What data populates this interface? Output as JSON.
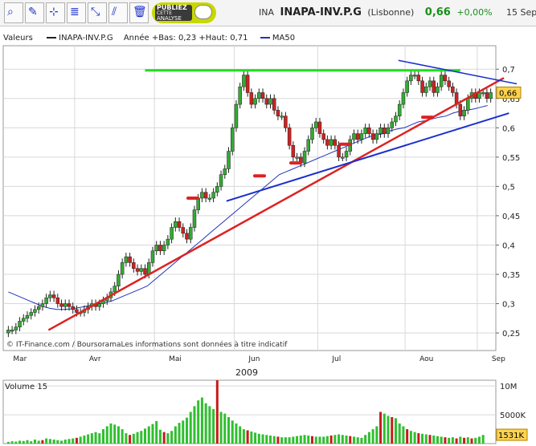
{
  "toolbar": {
    "tools": [
      "zoom-icon",
      "pencil-icon",
      "crosshair-icon",
      "fibonacci-icon",
      "arrows-icon",
      "channel-icon",
      "trash-icon"
    ],
    "ad_line1": "PUBLIEZ",
    "ad_line2": "CETTE",
    "ad_line3": "ANALYSE"
  },
  "quote": {
    "code": "INA",
    "name": "INAPA-INV.P.G",
    "market": "(Lisbonne)",
    "price": "0,66",
    "change": "+0,00%",
    "date": "15 Sep"
  },
  "legend": {
    "label": "Valeurs",
    "series_name": "INAPA-INV.P.G",
    "info": "Année +Bas: 0,23 +Haut: 0,71",
    "ma_name": "MA50"
  },
  "colors": {
    "up": "#33aa33",
    "down": "#cc2222",
    "ma": "#2233bb",
    "trend": "#dd2222",
    "support": "#1a2fcc",
    "resistance": "#22dd22",
    "volume_up": "#2fbf2f",
    "volume_down": "#c41c1c",
    "grid": "#d8d8d8"
  },
  "credit": "© IT-Finance.com / BoursoramaLes informations sont données à titre indicatif",
  "current_price_label": "0,66",
  "current_volume_label": "1531K",
  "chart_data": [
    {
      "type": "candlestick",
      "ticker": "INAPA-INV.P.G",
      "year": "2009",
      "x_labels": [
        "Mar",
        "Avr",
        "Mai",
        "Jun",
        "Jul",
        "Aou",
        "Sep"
      ],
      "y_tick_labels": [
        "0,25",
        "0,3",
        "0,35",
        "0,4",
        "0,45",
        "0,5",
        "0,55",
        "0,6",
        "0,65",
        "0,7"
      ],
      "y_ticks": [
        0.25,
        0.3,
        0.35,
        0.4,
        0.45,
        0.5,
        0.55,
        0.6,
        0.65,
        0.7
      ],
      "ylim": [
        0.22,
        0.74
      ],
      "grid": true,
      "closes": [
        0.255,
        0.255,
        0.26,
        0.27,
        0.275,
        0.28,
        0.285,
        0.29,
        0.295,
        0.3,
        0.31,
        0.315,
        0.31,
        0.3,
        0.295,
        0.3,
        0.295,
        0.29,
        0.285,
        0.285,
        0.29,
        0.295,
        0.3,
        0.295,
        0.3,
        0.305,
        0.31,
        0.32,
        0.33,
        0.35,
        0.37,
        0.38,
        0.37,
        0.36,
        0.355,
        0.36,
        0.35,
        0.37,
        0.39,
        0.4,
        0.39,
        0.4,
        0.41,
        0.43,
        0.44,
        0.43,
        0.42,
        0.41,
        0.43,
        0.46,
        0.48,
        0.49,
        0.48,
        0.48,
        0.49,
        0.5,
        0.52,
        0.53,
        0.56,
        0.6,
        0.64,
        0.67,
        0.69,
        0.66,
        0.64,
        0.65,
        0.66,
        0.65,
        0.64,
        0.65,
        0.63,
        0.62,
        0.62,
        0.6,
        0.57,
        0.55,
        0.55,
        0.54,
        0.56,
        0.58,
        0.6,
        0.61,
        0.59,
        0.58,
        0.57,
        0.58,
        0.57,
        0.55,
        0.55,
        0.56,
        0.58,
        0.59,
        0.58,
        0.59,
        0.6,
        0.59,
        0.58,
        0.59,
        0.6,
        0.59,
        0.6,
        0.61,
        0.62,
        0.64,
        0.66,
        0.68,
        0.69,
        0.69,
        0.68,
        0.66,
        0.67,
        0.68,
        0.66,
        0.67,
        0.69,
        0.68,
        0.67,
        0.66,
        0.64,
        0.62,
        0.63,
        0.65,
        0.66,
        0.65,
        0.66,
        0.66,
        0.65,
        0.66
      ],
      "ma50": [
        0.32,
        0.315,
        0.31,
        0.305,
        0.3,
        0.295,
        0.292,
        0.29,
        0.29,
        0.291,
        0.293,
        0.295,
        0.298,
        0.3,
        0.302,
        0.305,
        0.31,
        0.315,
        0.32,
        0.325,
        0.33,
        0.34,
        0.35,
        0.36,
        0.37,
        0.38,
        0.39,
        0.4,
        0.41,
        0.42,
        0.43,
        0.44,
        0.45,
        0.46,
        0.47,
        0.48,
        0.49,
        0.5,
        0.51,
        0.52,
        0.525,
        0.53,
        0.535,
        0.54,
        0.545,
        0.55,
        0.555,
        0.56,
        0.565,
        0.57,
        0.575,
        0.58,
        0.585,
        0.588,
        0.59,
        0.595,
        0.598,
        0.6,
        0.605,
        0.61,
        0.612,
        0.615,
        0.618,
        0.62,
        0.625,
        0.628,
        0.63,
        0.632,
        0.635,
        0.638
      ],
      "annotations": {
        "resistance_level": 0.698,
        "main_trendline": [
          [
            0,
            0.255
          ],
          [
            127,
            0.685
          ]
        ],
        "support_trendline": [
          [
            13,
            0.475
          ],
          [
            117,
            0.625
          ]
        ],
        "triangle_top": [
          [
            90,
            0.715
          ],
          [
            118,
            0.675
          ]
        ]
      },
      "last_price": 0.66
    },
    {
      "type": "bar",
      "title": "Volume 15",
      "y_tick_labels": [
        "10M",
        "5000K"
      ],
      "y_ticks": [
        10000000,
        5000000
      ],
      "ylim": [
        0,
        11000000
      ],
      "values": [
        300000,
        400000,
        350000,
        500000,
        450000,
        600000,
        400000,
        700000,
        500000,
        600000,
        900000,
        800000,
        700000,
        600000,
        500000,
        700000,
        800000,
        900000,
        1000000,
        1200000,
        1400000,
        1600000,
        1800000,
        2000000,
        1800000,
        2500000,
        3000000,
        3500000,
        3300000,
        3000000,
        2500000,
        1800000,
        1500000,
        1700000,
        2000000,
        2200000,
        2600000,
        3000000,
        3400000,
        3900000,
        2400000,
        2000000,
        1800000,
        2200000,
        3000000,
        3600000,
        4000000,
        4500000,
        5500000,
        6500000,
        7500000,
        8000000,
        7000000,
        6500000,
        6000000,
        11500000,
        5500000,
        5200000,
        4600000,
        4000000,
        3500000,
        3000000,
        2500000,
        2300000,
        2100000,
        1900000,
        1700000,
        1600000,
        1500000,
        1400000,
        1300000,
        1200000,
        1100000,
        1100000,
        1100000,
        1200000,
        1300000,
        1400000,
        1500000,
        1400000,
        1300000,
        1200000,
        1200000,
        1200000,
        1300000,
        1400000,
        1500000,
        1600000,
        1500000,
        1400000,
        1300000,
        1200000,
        1100000,
        1000000,
        1500000,
        2000000,
        2500000,
        3000000,
        5500000,
        5200000,
        4800000,
        4600000,
        4400000,
        3500000,
        3000000,
        2500000,
        2200000,
        2000000,
        1800000,
        1700000,
        1600000,
        1500000,
        1400000,
        1300000,
        1200000,
        1100000,
        1000000,
        1100000,
        900000,
        1200000,
        1000000,
        1100000,
        900000,
        1000000,
        1200000,
        1500000
      ],
      "down_days": [
        9,
        18,
        32,
        41,
        55,
        63,
        71,
        80,
        85,
        90,
        98,
        101,
        105,
        108,
        111,
        115,
        118,
        120,
        122
      ],
      "last_volume": 1531000
    }
  ]
}
